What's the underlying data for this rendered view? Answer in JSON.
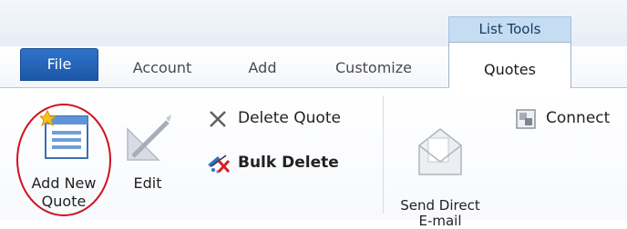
{
  "contextual_group": {
    "title": "List Tools"
  },
  "tabs": {
    "file": "File",
    "account": "Account",
    "add": "Add",
    "customize": "Customize",
    "quotes": "Quotes"
  },
  "ribbon": {
    "add_new_quote": "Add New\nQuote",
    "edit": "Edit",
    "delete_quote": "Delete Quote",
    "bulk_delete": "Bulk Delete",
    "send_direct_email": "Send Direct\nE-mail",
    "connect": "Connect"
  },
  "colors": {
    "file_tab": "#1c58a8",
    "context_group": "#c6dcf1",
    "highlight_circle": "#d0111b"
  }
}
